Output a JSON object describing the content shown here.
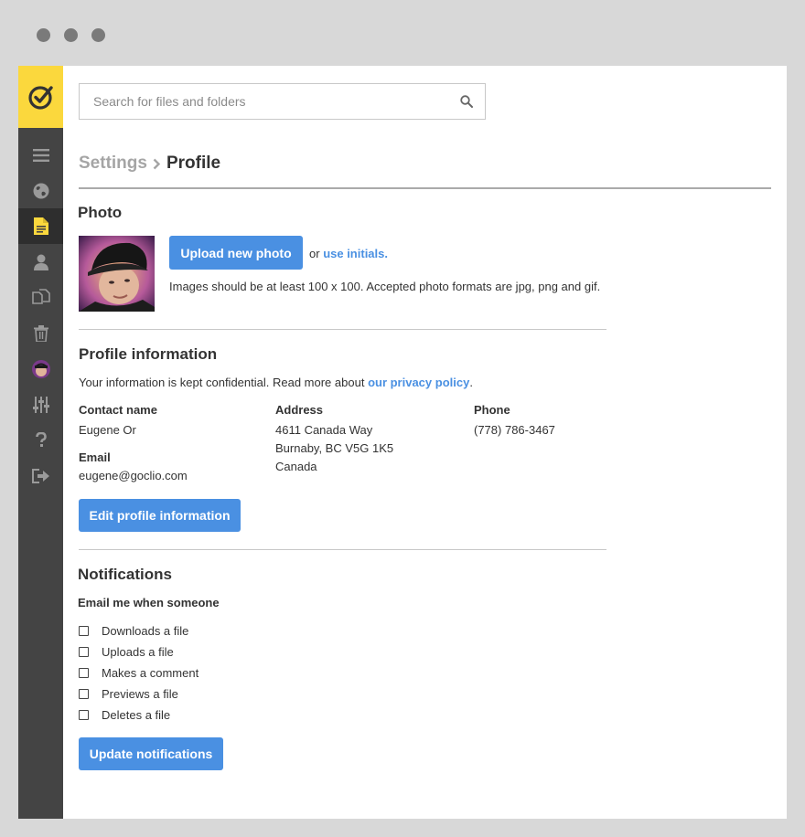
{
  "search": {
    "placeholder": "Search for files and folders"
  },
  "breadcrumb": {
    "parent": "Settings",
    "current": "Profile"
  },
  "photo": {
    "heading": "Photo",
    "upload_label": "Upload new photo",
    "or_text": "or",
    "initials_link": "use initials",
    "period": ".",
    "hint": "Images should be at least 100 x 100. Accepted photo formats are jpg, png and gif."
  },
  "profile": {
    "heading": "Profile information",
    "notice": "Your information is kept confidential. Read more about",
    "privacy_link": "our privacy policy",
    "period": ".",
    "contact_label": "Contact name",
    "contact_value": "Eugene Or",
    "email_label": "Email",
    "email_value": "eugene@goclio.com",
    "address_label": "Address",
    "address_lines": [
      "4611 Canada Way",
      "Burnaby, BC V5G 1K5",
      "Canada"
    ],
    "phone_label": "Phone",
    "phone_value": "(778) 786-3467",
    "edit_label": "Edit profile information"
  },
  "notifications": {
    "heading": "Notifications",
    "subheading": "Email me when someone",
    "options": [
      "Downloads a file",
      "Uploads a file",
      "Makes a comment",
      "Previews a file",
      "Deletes a file"
    ],
    "update_label": "Update notifications"
  },
  "colors": {
    "accent": "#4a90e2",
    "brand": "#fbd83d",
    "sidebar": "#444444"
  },
  "icons": {
    "sidebar": [
      "menu-icon",
      "globe-icon",
      "document-icon",
      "user-icon",
      "copy-icon",
      "trash-icon",
      "avatar",
      "sliders-icon",
      "help-icon",
      "logout-icon"
    ]
  }
}
